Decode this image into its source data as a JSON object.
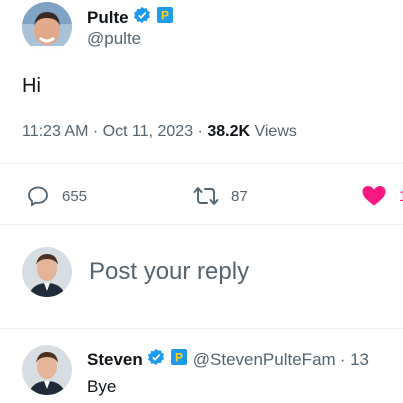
{
  "tweet": {
    "author_name": "Pulte",
    "author_handle": "@pulte",
    "text": "Hi",
    "time": "11:23 AM",
    "sep": "·",
    "date": "Oct 11, 2023",
    "views_count": "38.2K",
    "views_label": "Views",
    "stats": {
      "replies": "655",
      "retweets": "87",
      "likes_partial": "1"
    }
  },
  "reply_box": {
    "placeholder": "Post your reply"
  },
  "reply": {
    "author_name": "Steven",
    "author_handle": "@StevenPulteFam",
    "time_partial": "· 13",
    "text": "Bye"
  },
  "colors": {
    "verified": "#1d9bf0",
    "badge_p": "#1d9bf0",
    "like": "#f91880",
    "muted": "#536471"
  },
  "icons": [
    "verified-badge-icon",
    "p-badge-icon",
    "reply-icon",
    "retweet-icon",
    "heart-icon"
  ]
}
